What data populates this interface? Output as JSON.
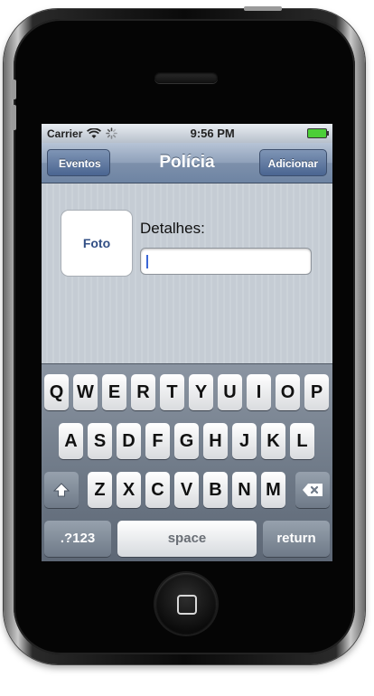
{
  "status_bar": {
    "carrier": "Carrier",
    "time": "9:56 PM"
  },
  "nav": {
    "back_label": "Eventos",
    "title": "Polícia",
    "action_label": "Adicionar"
  },
  "form": {
    "photo_label": "Foto",
    "details_label": "Detalhes:",
    "details_value": ""
  },
  "keyboard": {
    "row1": [
      "Q",
      "W",
      "E",
      "R",
      "T",
      "Y",
      "U",
      "I",
      "O",
      "P"
    ],
    "row2": [
      "A",
      "S",
      "D",
      "F",
      "G",
      "H",
      "J",
      "K",
      "L"
    ],
    "row3": [
      "Z",
      "X",
      "C",
      "V",
      "B",
      "N",
      "M"
    ],
    "numbers_label": ".?123",
    "space_label": "space",
    "return_label": "return"
  },
  "colors": {
    "nav_bar": "#7d90ab",
    "accent_text": "#324f85",
    "battery": "#4ccf38"
  }
}
